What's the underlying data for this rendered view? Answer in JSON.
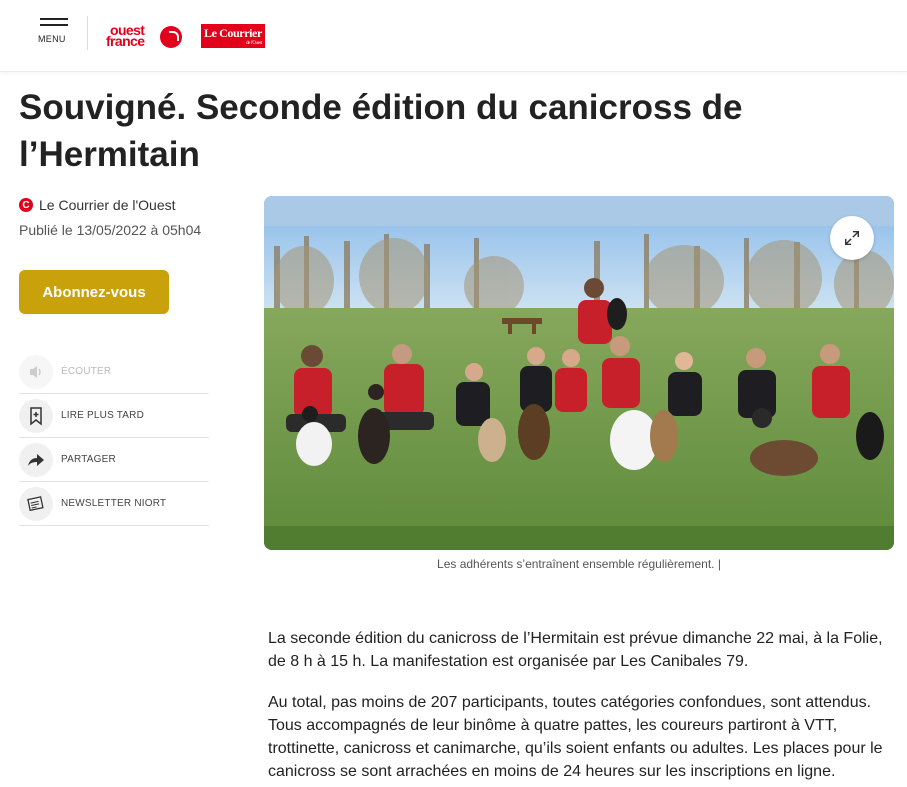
{
  "header": {
    "menu_label": "MENU",
    "logo_of_line1": "ouest",
    "logo_of_line2": "france",
    "logo_cdo": "Le Courrier",
    "logo_cdo_sub": "de l'Ouest"
  },
  "article": {
    "title": "Souvigné. Seconde édition du canicross de l’Hermitain",
    "source": "Le Courrier de l'Ouest",
    "source_icon": "C",
    "published": "Publié le 13/05/2022 à 05h04",
    "subscribe_label": "Abonnez-vous",
    "caption": "Les adhérents s’entraînent ensemble régulièrement. |",
    "paragraphs": [
      "La seconde édition du canicross de l’Hermitain est prévue dimanche 22 mai, à la Folie, de 8 h à 15 h. La manifestation est organisée par Les Canibales 79.",
      "Au total, pas moins de 207 participants, toutes catégories confondues, sont attendus. Tous accompagnés de leur binôme à quatre pattes, les coureurs partiront à VTT, trottinette, canicross et canimarche, qu’ils soient enfants ou adultes. Les places pour le canicross se sont arrachées en moins de 24 heures sur les inscriptions en ligne."
    ]
  },
  "actions": [
    {
      "label": "ÉCOUTER",
      "icon": "audio-icon",
      "disabled": true
    },
    {
      "label": "LIRE PLUS TARD",
      "icon": "bookmark-add-icon",
      "disabled": false
    },
    {
      "label": "PARTAGER",
      "icon": "share-icon",
      "disabled": false
    },
    {
      "label": "NEWSLETTER NIORT",
      "icon": "newsletter-icon",
      "disabled": false
    }
  ],
  "colors": {
    "brand_red": "#e2001a",
    "subscribe_gold": "#c9a10a"
  }
}
